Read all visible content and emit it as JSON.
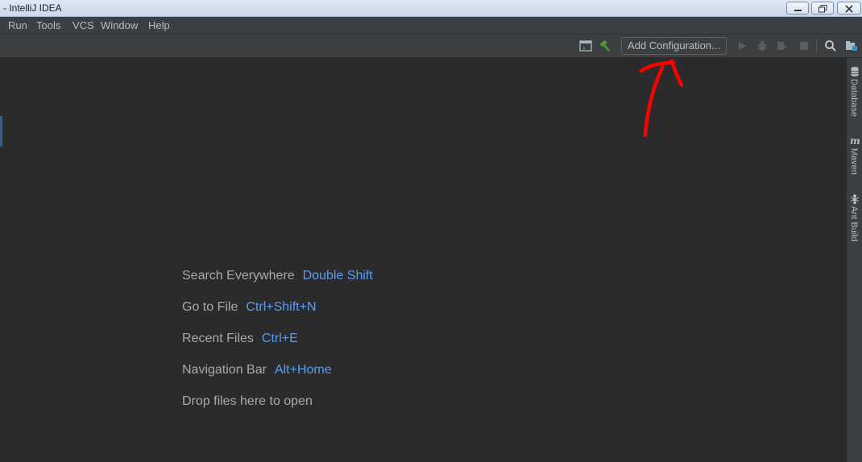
{
  "window": {
    "title": "- IntelliJ IDEA"
  },
  "menu": {
    "items": [
      "Run",
      "Tools",
      "VCS",
      "Window",
      "Help"
    ]
  },
  "toolbar": {
    "add_configuration_label": "Add Configuration...",
    "icons": [
      "project-structure-icon",
      "build-hammer-icon",
      "run-icon",
      "debug-icon",
      "coverage-icon",
      "stop-icon",
      "search-icon",
      "project-view-icon"
    ]
  },
  "editor": {
    "hints": [
      {
        "label": "Search Everywhere",
        "shortcut": "Double Shift"
      },
      {
        "label": "Go to File",
        "shortcut": "Ctrl+Shift+N"
      },
      {
        "label": "Recent Files",
        "shortcut": "Ctrl+E"
      },
      {
        "label": "Navigation Bar",
        "shortcut": "Alt+Home"
      },
      {
        "label": "Drop files here to open",
        "shortcut": ""
      }
    ]
  },
  "right_stripe": {
    "tools": [
      {
        "label": "Database",
        "icon": "database-icon"
      },
      {
        "label": "Maven",
        "icon": "maven-icon"
      },
      {
        "label": "Ant Build",
        "icon": "ant-icon"
      }
    ]
  },
  "colors": {
    "background": "#2b2b2b",
    "panel": "#3c3f41",
    "shortcut_blue": "#589df6",
    "annotation_red": "#ff0000",
    "build_green": "#4e9a3a"
  }
}
